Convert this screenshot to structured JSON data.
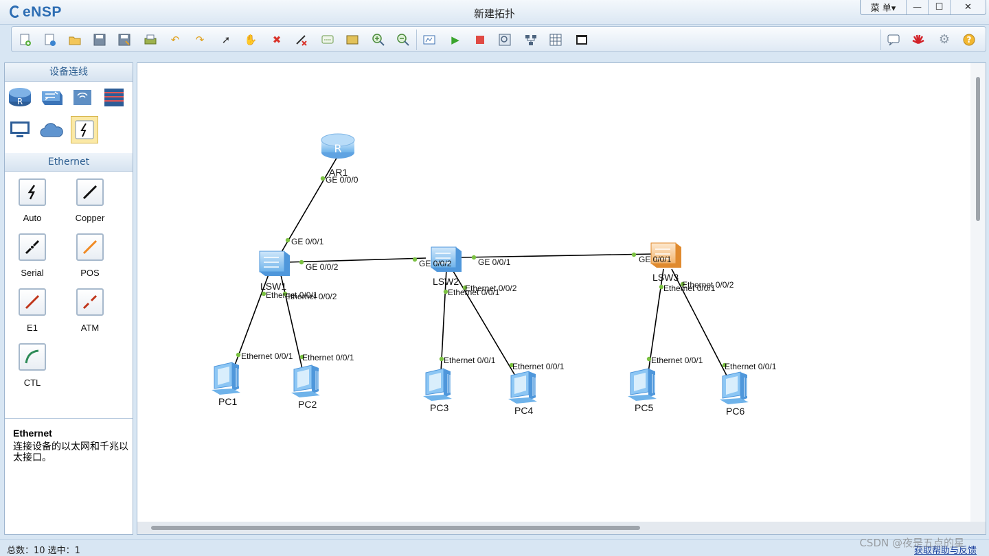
{
  "app": {
    "logo_text": "eNSP",
    "window_title": "新建拓扑"
  },
  "window_controls": {
    "menu_label": "菜 单▾",
    "minimize": "—",
    "maximize": "☐",
    "close": "✕"
  },
  "toolbar": {
    "left_icons": [
      "new-topology-icon",
      "new-example-icon",
      "open-icon",
      "save-icon",
      "save-as-icon",
      "print-icon",
      "undo-icon",
      "redo-icon",
      "select-pointer-icon",
      "hand-pan-icon",
      "delete-icon",
      "delete-link-icon",
      "text-note-icon",
      "rectangle-icon",
      "zoom-in-icon",
      "zoom-out-icon",
      "fit-view-icon",
      "start-device-icon",
      "stop-device-icon",
      "capture-icon",
      "topology-layout-icon",
      "grid-icon",
      "screenshot-icon"
    ],
    "right_icons": [
      "message-icon",
      "huawei-logo-icon",
      "settings-gear-icon",
      "help-icon"
    ]
  },
  "left_panel": {
    "devices_header": "设备连线",
    "device_icons": [
      "router-icon",
      "switch-icon",
      "wireless-icon",
      "firewall-icon",
      "pc-terminal-icon",
      "cloud-icon",
      "auto-connect-icon"
    ],
    "connections_header": "Ethernet",
    "connections": [
      {
        "label": "Auto",
        "color": "#111111"
      },
      {
        "label": "Copper",
        "color": "#111111"
      },
      {
        "label": "Serial",
        "color": "#111111"
      },
      {
        "label": "POS",
        "color": "#f08a24"
      },
      {
        "label": "E1",
        "color": "#c0361b"
      },
      {
        "label": "ATM",
        "color": "#c0361b"
      },
      {
        "label": "CTL",
        "color": "#2e8b57"
      }
    ],
    "description": {
      "title": "Ethernet",
      "text": "连接设备的以太网和千兆以太接口。"
    }
  },
  "topology": {
    "nodes": [
      {
        "name": "AR1",
        "type": "router"
      },
      {
        "name": "LSW1",
        "type": "switch"
      },
      {
        "name": "LSW2",
        "type": "switch"
      },
      {
        "name": "LSW3",
        "type": "switch-selected"
      },
      {
        "name": "PC1",
        "type": "pc"
      },
      {
        "name": "PC2",
        "type": "pc"
      },
      {
        "name": "PC3",
        "type": "pc"
      },
      {
        "name": "PC4",
        "type": "pc"
      },
      {
        "name": "PC5",
        "type": "pc"
      },
      {
        "name": "PC6",
        "type": "pc"
      }
    ],
    "port_labels": [
      "GE 0/0/0",
      "GE 0/0/1",
      "GE 0/0/2",
      "GE 0/0/2",
      "GE 0/0/1",
      "GE 0/0/1",
      "Ethernet 0/0/1",
      "Ethernet 0/0/2",
      "Ethernet 0/0/1",
      "Ethernet 0/0/2",
      "Ethernet 0/0/1",
      "Ethernet 0/0/2",
      "Ethernet 0/0/1",
      "Ethernet 0/0/1",
      "Ethernet 0/0/1",
      "Ethernet 0/0/1",
      "Ethernet 0/0/1",
      "Ethernet 0/0/1"
    ],
    "link_color": "#000000",
    "port_dot_color": "#7bc142"
  },
  "status": {
    "text": "总数：10  选中：1",
    "feedback": "获取帮助与反馈"
  },
  "watermark": "CSDN @夜是五点的星"
}
